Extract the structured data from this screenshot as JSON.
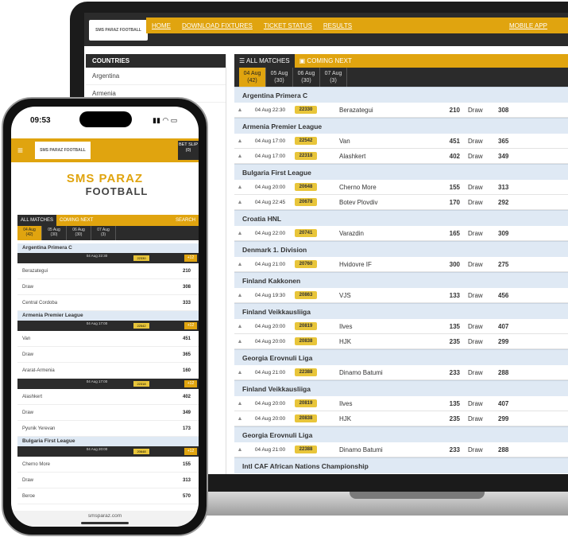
{
  "laptop": {
    "logo_text": "SMS PARAZ FOOTBALL",
    "nav": [
      "HOME",
      "DOWNLOAD FIXTURES",
      "TICKET STATUS",
      "RESULTS",
      "MOBILE APP"
    ],
    "sidebar": {
      "title": "COUNTRIES",
      "items": [
        "Argentina",
        "Armenia"
      ]
    },
    "tabs": [
      "ALL MATCHES",
      "COMING NEXT"
    ],
    "dates": [
      {
        "day": "04 Aug",
        "count": "(42)"
      },
      {
        "day": "05 Aug",
        "count": "(30)"
      },
      {
        "day": "06 Aug",
        "count": "(30)"
      },
      {
        "day": "07 Aug",
        "count": "(3)"
      }
    ],
    "draw_label": "Draw",
    "leagues": [
      {
        "name": "Argentina Primera C",
        "matches": [
          {
            "time": "04 Aug 22:30",
            "code": "22330",
            "team": "Berazategui",
            "odds1": "210",
            "odds2": "308"
          }
        ]
      },
      {
        "name": "Armenia Premier League",
        "matches": [
          {
            "time": "04 Aug 17:00",
            "code": "22542",
            "team": "Van",
            "odds1": "451",
            "odds2": "365"
          },
          {
            "time": "04 Aug 17:00",
            "code": "22318",
            "team": "Alashkert",
            "odds1": "402",
            "odds2": "349"
          }
        ]
      },
      {
        "name": "Bulgaria First League",
        "matches": [
          {
            "time": "04 Aug 20:00",
            "code": "20648",
            "team": "Cherno More",
            "odds1": "155",
            "odds2": "313"
          },
          {
            "time": "04 Aug 22:45",
            "code": "20678",
            "team": "Botev Plovdiv",
            "odds1": "170",
            "odds2": "292"
          }
        ]
      },
      {
        "name": "Croatia HNL",
        "matches": [
          {
            "time": "04 Aug 22:00",
            "code": "20741",
            "team": "Varazdin",
            "odds1": "165",
            "odds2": "309"
          }
        ]
      },
      {
        "name": "Denmark 1. Division",
        "matches": [
          {
            "time": "04 Aug 21:00",
            "code": "20760",
            "team": "Hvidovre IF",
            "odds1": "300",
            "odds2": "275"
          }
        ]
      },
      {
        "name": "Finland Kakkonen",
        "matches": [
          {
            "time": "04 Aug 19:30",
            "code": "20863",
            "team": "VJS",
            "odds1": "133",
            "odds2": "456"
          }
        ]
      },
      {
        "name": "Finland Veikkausliiga",
        "matches": [
          {
            "time": "04 Aug 20:00",
            "code": "20819",
            "team": "Ilves",
            "odds1": "135",
            "odds2": "407"
          },
          {
            "time": "04 Aug 20:00",
            "code": "20838",
            "team": "HJK",
            "odds1": "235",
            "odds2": "299"
          }
        ]
      },
      {
        "name": "Georgia Erovnuli Liga",
        "matches": [
          {
            "time": "04 Aug 21:00",
            "code": "22388",
            "team": "Dinamo Batumi",
            "odds1": "233",
            "odds2": "288"
          }
        ]
      },
      {
        "name": "Finland Veikkausliiga",
        "matches": [
          {
            "time": "04 Aug 20:00",
            "code": "20819",
            "team": "Ilves",
            "odds1": "135",
            "odds2": "407"
          },
          {
            "time": "04 Aug 20:00",
            "code": "20838",
            "team": "HJK",
            "odds1": "235",
            "odds2": "299"
          }
        ]
      },
      {
        "name": "Georgia Erovnuli Liga",
        "matches": [
          {
            "time": "04 Aug 21:00",
            "code": "22388",
            "team": "Dinamo Batumi",
            "odds1": "233",
            "odds2": "288"
          }
        ]
      },
      {
        "name": "Intl CAF African Nations Championship",
        "matches": []
      }
    ]
  },
  "phone": {
    "clock": "09:53",
    "logo_text": "SMS PARAZ FOOTBALL",
    "betslip": "BET SLIP (0)",
    "brand_line1": "SMS PARAZ",
    "brand_line2": "FOOTBALL",
    "tabs": [
      "ALL MATCHES",
      "COMING NEXT",
      "SEARCH"
    ],
    "dates": [
      {
        "day": "04 Aug",
        "count": "(42)"
      },
      {
        "day": "05 Aug",
        "count": "(30)"
      },
      {
        "day": "06 Aug",
        "count": "(30)"
      },
      {
        "day": "07 Aug",
        "count": "(3)"
      }
    ],
    "url": "smsparaz.com",
    "leagues": [
      {
        "name": "Argentina Primera C",
        "time": "04 Aug 22:30",
        "code": "22330",
        "plus": "+12",
        "rows": [
          {
            "label": "Berazategui",
            "odds": "210"
          },
          {
            "label": "Draw",
            "odds": "308"
          },
          {
            "label": "Central Cordoba",
            "odds": "333"
          }
        ]
      },
      {
        "name": "Armenia Premier League",
        "time": "04 Aug 17:00",
        "code": "22542",
        "plus": "+12",
        "rows": [
          {
            "label": "Van",
            "odds": "451"
          },
          {
            "label": "Draw",
            "odds": "365"
          },
          {
            "label": "Ararat-Armenia",
            "odds": "160"
          }
        ]
      },
      {
        "name": "",
        "time": "04 Aug 17:00",
        "code": "22318",
        "plus": "+12",
        "rows": [
          {
            "label": "Alashkert",
            "odds": "402"
          },
          {
            "label": "Draw",
            "odds": "349"
          },
          {
            "label": "Pyunik Yerevan",
            "odds": "173"
          }
        ]
      },
      {
        "name": "Bulgaria First League",
        "time": "04 Aug 20:00",
        "code": "20648",
        "plus": "+12",
        "rows": [
          {
            "label": "Cherno More",
            "odds": "155"
          },
          {
            "label": "Draw",
            "odds": "313"
          },
          {
            "label": "Beroe",
            "odds": "570"
          }
        ]
      }
    ]
  }
}
